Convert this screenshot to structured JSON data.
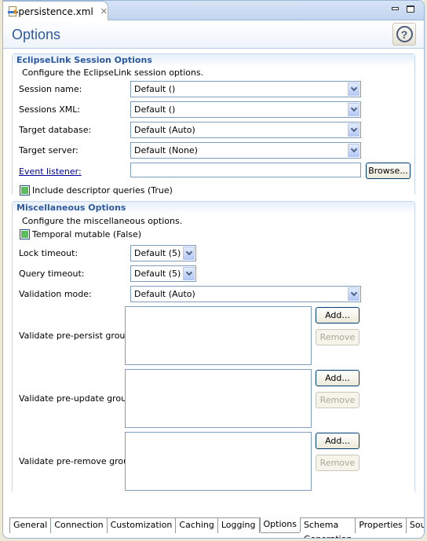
{
  "editor_tab": {
    "title": "persistence.xml",
    "icon": "xml-file-icon"
  },
  "page": {
    "title": "Options"
  },
  "session_section": {
    "title": "EclipseLink Session Options",
    "description": "Configure the EclipseLink session options.",
    "fields": [
      {
        "label": "Session name:",
        "value": "Default ()"
      },
      {
        "label": "Sessions XML:",
        "value": "Default ()"
      },
      {
        "label": "Target database:",
        "value": "Default (Auto)"
      },
      {
        "label": "Target server:",
        "value": "Default (None)"
      }
    ],
    "event_listener": {
      "label": "Event listener:",
      "value": "",
      "browse_label": "Browse..."
    },
    "include_descriptor_queries": {
      "label": "Include descriptor queries (True)",
      "checked": true
    }
  },
  "misc_section": {
    "title": "Miscellaneous Options",
    "description": "Configure the miscellaneous options.",
    "temporal_mutable": {
      "label": "Temporal mutable (False)",
      "checked": true
    },
    "lock_timeout": {
      "label": "Lock timeout:",
      "value": "Default (5)"
    },
    "query_timeout": {
      "label": "Query timeout:",
      "value": "Default (5)"
    },
    "validation_mode": {
      "label": "Validation mode:",
      "value": "Default (Auto)"
    },
    "groups": [
      {
        "label": "Validate pre-persist group:",
        "add_label": "Add...",
        "remove_label": "Remove"
      },
      {
        "label": "Validate pre-update group:",
        "add_label": "Add...",
        "remove_label": "Remove"
      },
      {
        "label": "Validate pre-remove group:",
        "add_label": "Add...",
        "remove_label": "Remove"
      }
    ]
  },
  "bottom_tabs": [
    {
      "label": "General",
      "active": false
    },
    {
      "label": "Connection",
      "active": false
    },
    {
      "label": "Customization",
      "active": false
    },
    {
      "label": "Caching",
      "active": false
    },
    {
      "label": "Logging",
      "active": false
    },
    {
      "label": "Options",
      "active": true
    },
    {
      "label": "Schema Generation",
      "active": false
    },
    {
      "label": "Properties",
      "active": false
    },
    {
      "label": "Source",
      "active": false
    }
  ]
}
